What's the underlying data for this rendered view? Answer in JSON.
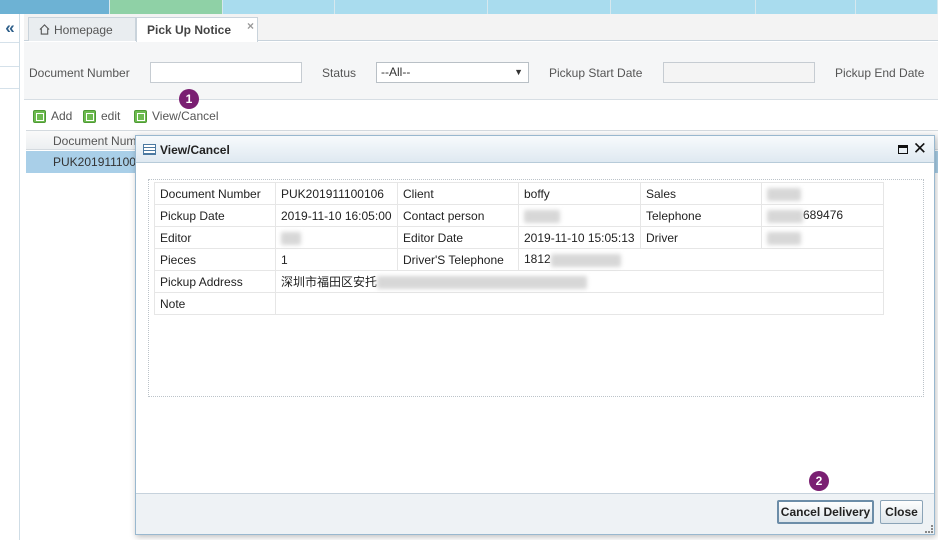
{
  "tabs": {
    "home": "Homepage",
    "active": "Pick Up Notice",
    "close_glyph": "×"
  },
  "filters": {
    "document_number_label": "Document Number",
    "status_label": "Status",
    "status_value": "--All--",
    "pickup_start_label": "Pickup Start Date",
    "pickup_end_label": "Pickup End Date"
  },
  "toolbar": {
    "add": "Add",
    "edit": "edit",
    "view_cancel": "View/Cancel"
  },
  "grid": {
    "header_document_number": "Document Num",
    "row_document_number": "PUK201911100"
  },
  "markers": {
    "m1": "1",
    "m2": "2"
  },
  "modal": {
    "title": "View/Cancel",
    "close_glyph": "✕",
    "rows": [
      {
        "l1": "Document Number",
        "v1": "PUK201911100106",
        "l2": "Client",
        "v2": "boffy",
        "l3": "Sales",
        "v3": ""
      },
      {
        "l1": "Pickup Date",
        "v1": "2019-11-10 16:05:00",
        "l2": "Contact person",
        "v2": "",
        "l3": "Telephone",
        "v3": "689476"
      },
      {
        "l1": "Editor",
        "v1": "",
        "l2": "Editor Date",
        "v2": "2019-11-10 15:05:13",
        "l3": "Driver",
        "v3": ""
      },
      {
        "l1": "Pieces",
        "v1": "1",
        "l2": "Driver'S Telephone",
        "v2": "1812"
      }
    ],
    "pickup_address_label": "Pickup Address",
    "pickup_address_value": "深圳市福田区安托",
    "note_label": "Note",
    "note_value": "",
    "cancel_delivery": "Cancel Delivery",
    "close": "Close"
  },
  "colors": {
    "strip": [
      "#6db2d4",
      "#8fd1a6",
      "#a9dcee",
      "#a9dcee",
      "#a9dcee",
      "#a9dcee",
      "#a9dcee",
      "#a9dcee"
    ],
    "selected_row": "#a9cfe8",
    "marker": "#7a1f72",
    "toolbar_icon": "#6dbb4f"
  }
}
